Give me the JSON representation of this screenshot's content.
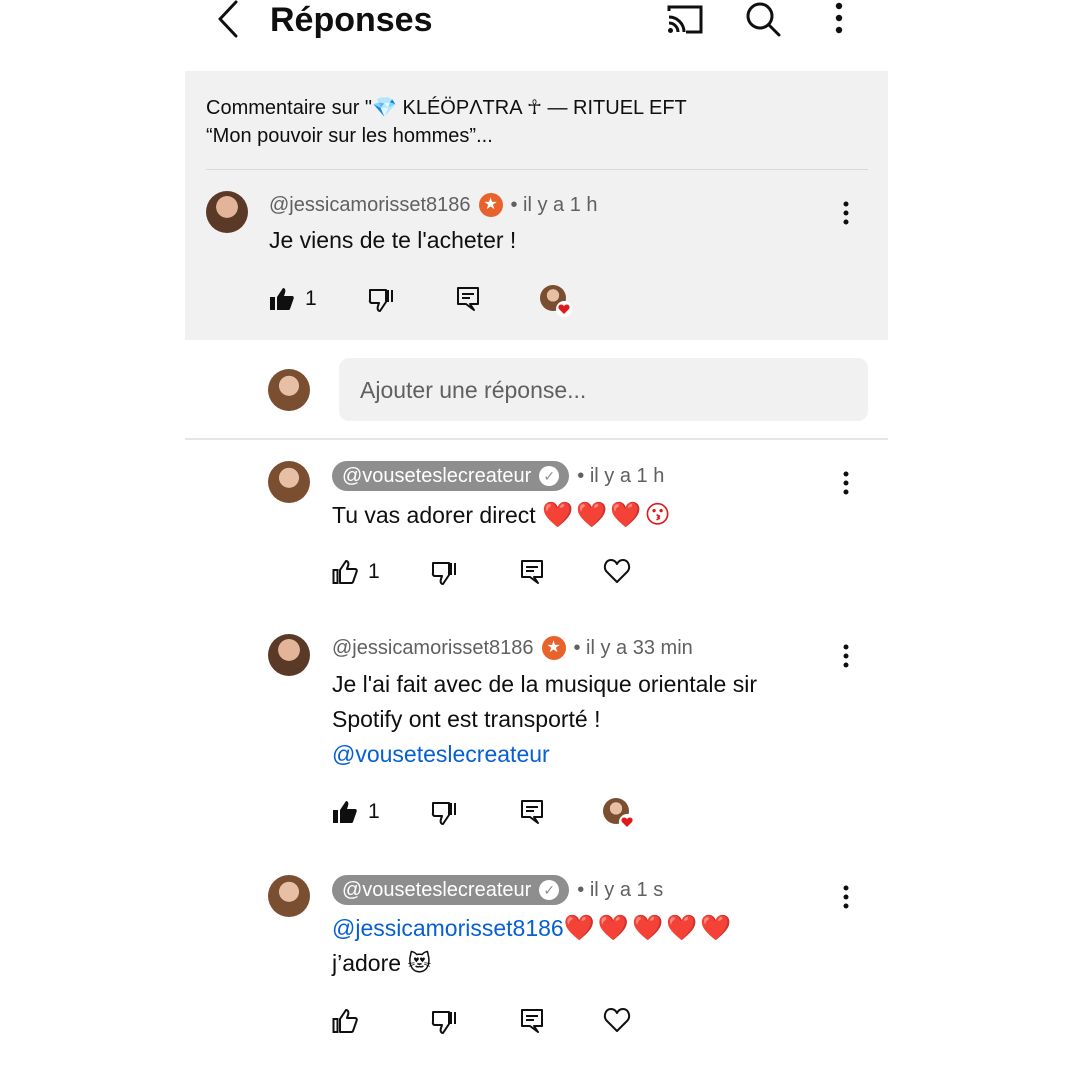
{
  "header": {
    "title": "Réponses"
  },
  "context": {
    "line1": "Commentaire sur \"💎 KLÉÖPΛTRA ☥ — RITUEL EFT",
    "line2": "“Mon pouvoir sur les hommes”..."
  },
  "parent": {
    "author": "@jessicamorisset8186",
    "time": "• il y a 1 h",
    "text": "Je viens de te l'acheter !",
    "likes": "1"
  },
  "reply_input": {
    "placeholder": "Ajouter une réponse..."
  },
  "replies": [
    {
      "author": "@vouseteslecreateur",
      "time": "• il y a 1 h",
      "text": "Tu vas adorer direct",
      "emoji": "❤️❤️❤️😗",
      "likes": "1"
    },
    {
      "author": "@jessicamorisset8186",
      "time": "• il y a 33 min",
      "line1": "Je l'ai fait avec de la musique orientale sir",
      "line2": "Spotify ont est transporté !",
      "mention": "@vouseteslecreateur",
      "likes": "1"
    },
    {
      "author": "@vouseteslecreateur",
      "time": "• il y a 1 s",
      "mention": "@jessicamorisset8186",
      "hearts": "❤️❤️❤️❤️❤️",
      "line2": "j’adore",
      "emoji2": "😻"
    }
  ],
  "colors": {
    "panel": "#f1f1f1",
    "mention": "#065fd4",
    "star_badge": "#e8622c",
    "heart": "#e0191c"
  }
}
